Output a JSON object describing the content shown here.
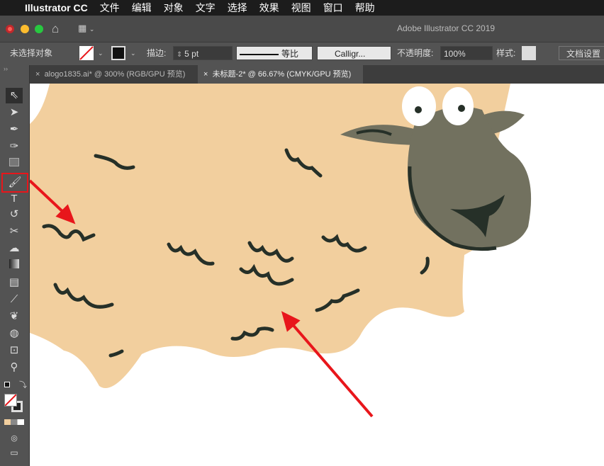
{
  "menubar": {
    "app": "Illustrator CC",
    "items": [
      "文件",
      "编辑",
      "对象",
      "文字",
      "选择",
      "效果",
      "视图",
      "窗口",
      "帮助"
    ]
  },
  "titlebar": {
    "title": "Adobe Illustrator CC 2019"
  },
  "control": {
    "selection": "未选择对象",
    "stroke_label": "描边:",
    "stroke_value": "5 pt",
    "profile": "等比",
    "brush": "Calligr...",
    "opacity_label": "不透明度:",
    "opacity_value": "100%",
    "style_label": "样式:",
    "doc_setup": "文档设置"
  },
  "tabs": [
    {
      "label": "alogo1835.ai* @ 300% (RGB/GPU 预览)",
      "close": "×"
    },
    {
      "label": "未标题-2* @ 66.67% (CMYK/GPU 预览)",
      "close": "×"
    }
  ],
  "colors": {
    "sheep_body": "#f2cf9e",
    "sheep_head": "#72715f",
    "stroke": "#263028",
    "highlight": "#e8161b"
  }
}
